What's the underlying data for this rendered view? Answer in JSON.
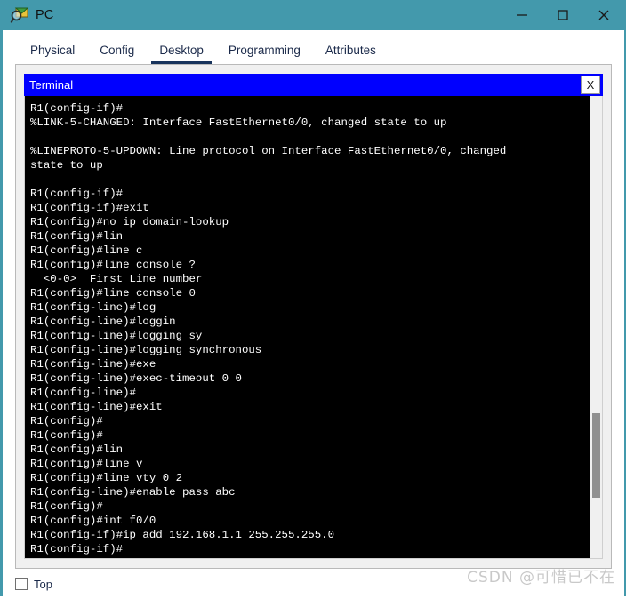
{
  "window": {
    "title": "PC",
    "icon": "inspect-magnifier-icon",
    "titlebar_color": "#4399AC",
    "controls": {
      "minimize": "–",
      "maximize": "□",
      "close": "✕"
    }
  },
  "tabs": [
    {
      "label": "Physical",
      "active": false
    },
    {
      "label": "Config",
      "active": false
    },
    {
      "label": "Desktop",
      "active": true
    },
    {
      "label": "Programming",
      "active": false
    },
    {
      "label": "Attributes",
      "active": false
    }
  ],
  "terminal": {
    "title": "Terminal",
    "close_label": "X",
    "header_color": "#0000FF",
    "background_color": "#000000",
    "text_color": "#FFFFFF",
    "lines": [
      "R1(config-if)#",
      "%LINK-5-CHANGED: Interface FastEthernet0/0, changed state to up",
      "",
      "%LINEPROTO-5-UPDOWN: Line protocol on Interface FastEthernet0/0, changed",
      "state to up",
      "",
      "R1(config-if)#",
      "R1(config-if)#exit",
      "R1(config)#no ip domain-lookup",
      "R1(config)#lin",
      "R1(config)#line c",
      "R1(config)#line console ?",
      "  <0-0>  First Line number",
      "R1(config)#line console 0",
      "R1(config-line)#log",
      "R1(config-line)#loggin",
      "R1(config-line)#logging sy",
      "R1(config-line)#logging synchronous",
      "R1(config-line)#exe",
      "R1(config-line)#exec-timeout 0 0",
      "R1(config-line)#",
      "R1(config-line)#exit",
      "R1(config)#",
      "R1(config)#",
      "R1(config)#lin",
      "R1(config)#line v",
      "R1(config)#line vty 0 2",
      "R1(config-line)#enable pass abc",
      "R1(config)#",
      "R1(config)#int f0/0",
      "R1(config-if)#ip add 192.168.1.1 255.255.255.0",
      "R1(config-if)#"
    ]
  },
  "bottom": {
    "top_checkbox_label": "Top",
    "top_checked": false
  },
  "watermark": {
    "text": "CSDN @可惜已不在"
  }
}
